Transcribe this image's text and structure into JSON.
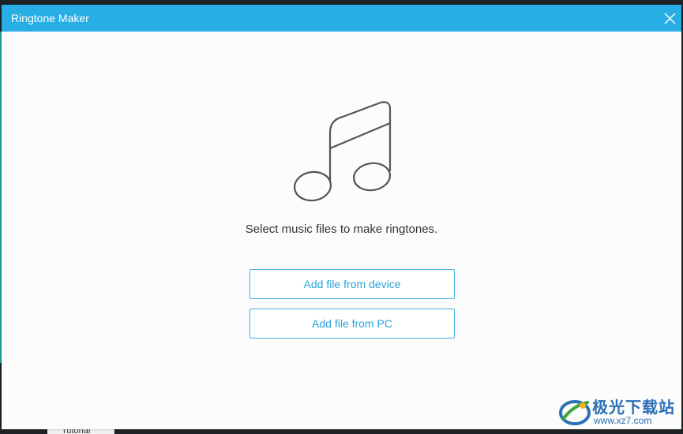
{
  "window": {
    "title": "Ringtone Maker"
  },
  "main": {
    "prompt": "Select music files to make ringtones.",
    "buttons": {
      "add_from_device": "Add file from device",
      "add_from_pc": "Add file from PC"
    }
  },
  "background": {
    "tab_label": "Tutorial"
  },
  "watermark": {
    "name": "极光下载站",
    "url": "www.xz7.com"
  },
  "colors": {
    "titlebar": "#27aee5",
    "button_border": "#46b2de",
    "button_text": "#2aa3d8",
    "icon_stroke": "#555555"
  },
  "icons": {
    "close": "close-icon",
    "music_note": "music-note-icon"
  }
}
